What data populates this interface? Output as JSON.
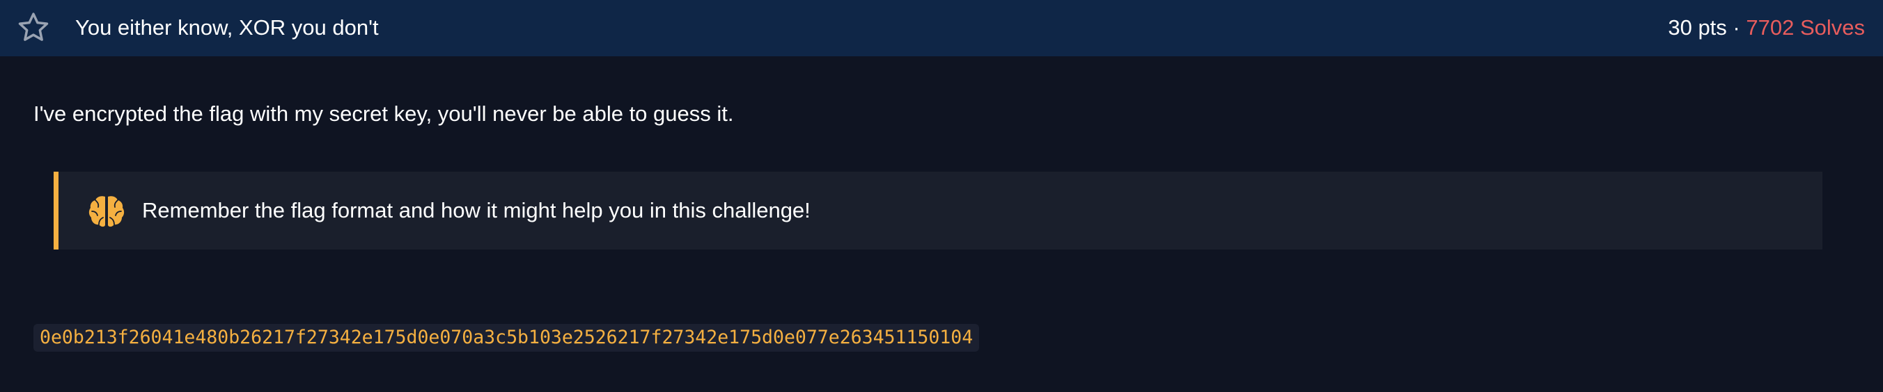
{
  "challenge": {
    "title": "You either know, XOR you don't",
    "points": "30 pts",
    "separator": "·",
    "solves": "7702 Solves",
    "description": "I've encrypted the flag with my secret key, you'll never be able to guess it.",
    "hint": {
      "icon": "brain-icon",
      "text": "Remember the flag format and how it might help you in this challenge!"
    },
    "ciphertext": "0e0b213f26041e480b26217f27342e175d0e070a3c5b103e2526217f27342e175d0e077e263451150104"
  },
  "colors": {
    "header_bg": "#0f2647",
    "page_bg": "#0f1422",
    "solves": "#e85d5d",
    "accent": "#f5b041",
    "hint_bg": "#1a1f2c"
  }
}
